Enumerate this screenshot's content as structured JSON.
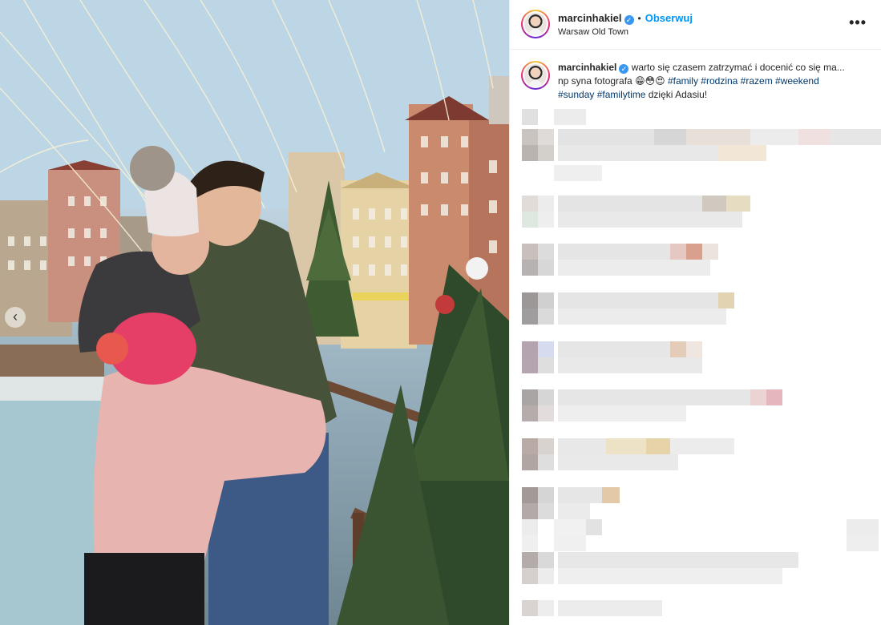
{
  "post": {
    "username": "marcinhakiel",
    "follow_label": "Obserwuj",
    "separator": "•",
    "location": "Warsaw Old Town",
    "more_icon": "•••",
    "carousel_arrow": "‹"
  },
  "caption": {
    "username": "marcinhakiel",
    "text_1": "warto się czasem zatrzymać i docenić co się ma...",
    "text_2": "np syna fotografa 😁😳😍",
    "hashtags_1": [
      "#family",
      "#rodzina",
      "#razem",
      "#weekend"
    ],
    "hashtags_2": [
      "#sunday",
      "#familytime"
    ],
    "text_3": "dzięki Adasiu!"
  },
  "colors": {
    "link_blue": "#0095f6",
    "hashtag": "#00376b",
    "verified": "#3897f0"
  }
}
